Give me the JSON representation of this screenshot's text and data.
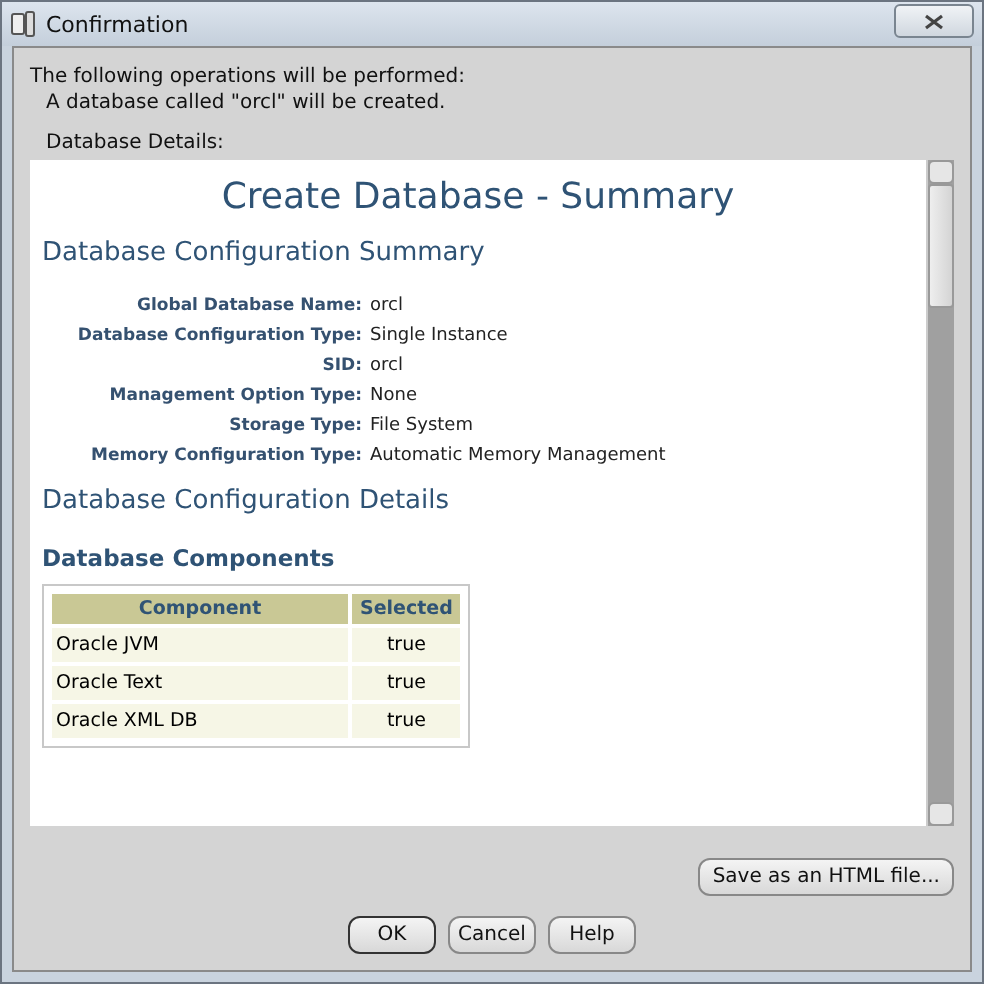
{
  "window": {
    "title": "Confirmation"
  },
  "intro": [
    "The following operations will be performed:",
    "A database called \"orcl\" will be created."
  ],
  "details_label": "Database Details:",
  "summary": {
    "title": "Create Database - Summary",
    "config_heading": "Database Configuration Summary",
    "fields": [
      {
        "label": "Global Database Name:",
        "value": "orcl"
      },
      {
        "label": "Database Configuration Type:",
        "value": "Single Instance"
      },
      {
        "label": "SID:",
        "value": "orcl"
      },
      {
        "label": "Management Option Type:",
        "value": "None"
      },
      {
        "label": "Storage Type:",
        "value": "File System"
      },
      {
        "label": "Memory Configuration Type:",
        "value": "Automatic Memory Management"
      }
    ],
    "details_heading": "Database Configuration Details",
    "components_heading": "Database Components",
    "table": {
      "columns": [
        "Component",
        "Selected"
      ],
      "rows": [
        [
          "Oracle JVM",
          "true"
        ],
        [
          "Oracle Text",
          "true"
        ],
        [
          "Oracle XML DB",
          "true"
        ]
      ]
    }
  },
  "save_button": "Save as an HTML file...",
  "buttons": [
    {
      "label": "OK",
      "default": true
    },
    {
      "label": "Cancel",
      "default": false
    },
    {
      "label": "Help",
      "default": false
    }
  ]
}
